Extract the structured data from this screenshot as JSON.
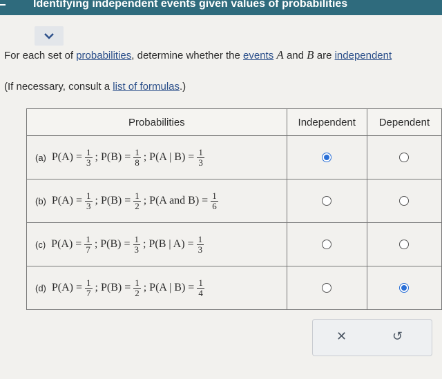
{
  "header": {
    "title": "Identifying independent events given values of probabilities"
  },
  "instructions": {
    "pre": "For each set of ",
    "link1": "probabilities",
    "mid1": ", determine whether the ",
    "link2": "events",
    "varA": "A",
    "and": " and ",
    "varB": "B",
    "mid2": " are ",
    "link3": "independent"
  },
  "note": {
    "pre": "(If necessary, consult a ",
    "link": "list of formulas",
    "post": ".)"
  },
  "table": {
    "headers": {
      "probabilities": "Probabilities",
      "independent": "Independent",
      "dependent": "Dependent"
    },
    "rows": [
      {
        "label": "(a)",
        "t1": "P(A) =",
        "n1": "1",
        "d1": "3",
        "t2": "; P(B) =",
        "n2": "1",
        "d2": "8",
        "t3": "; P(A | B) =",
        "n3": "1",
        "d3": "3",
        "selected": "independent"
      },
      {
        "label": "(b)",
        "t1": "P(A) =",
        "n1": "1",
        "d1": "3",
        "t2": "; P(B) =",
        "n2": "1",
        "d2": "2",
        "t3": "; P(A and B) =",
        "n3": "1",
        "d3": "6",
        "selected": "none"
      },
      {
        "label": "(c)",
        "t1": "P(A) =",
        "n1": "1",
        "d1": "7",
        "t2": "; P(B) =",
        "n2": "1",
        "d2": "3",
        "t3": "; P(B | A) =",
        "n3": "1",
        "d3": "3",
        "selected": "none"
      },
      {
        "label": "(d)",
        "t1": "P(A) =",
        "n1": "1",
        "d1": "7",
        "t2": "; P(B) =",
        "n2": "1",
        "d2": "2",
        "t3": "; P(A | B) =",
        "n3": "1",
        "d3": "4",
        "selected": "dependent"
      }
    ]
  },
  "actions": {
    "clear_icon": "close-icon",
    "undo_icon": "undo-icon",
    "clear_glyph": "✕",
    "undo_glyph": "↺"
  },
  "colors": {
    "accent": "#2a6fd6",
    "header_bar": "#2f6b7d"
  }
}
